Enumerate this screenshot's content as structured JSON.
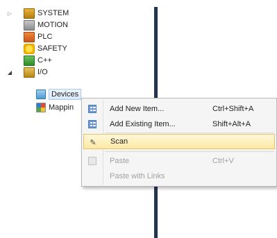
{
  "tree": {
    "items": [
      {
        "label": "SYSTEM",
        "icon": "system-icon",
        "expander": "collapsed"
      },
      {
        "label": "MOTION",
        "icon": "motion-icon"
      },
      {
        "label": "PLC",
        "icon": "plc-icon"
      },
      {
        "label": "SAFETY",
        "icon": "safety-icon"
      },
      {
        "label": "C++",
        "icon": "cpp-icon"
      },
      {
        "label": "I/O",
        "icon": "io-icon",
        "expander": "expanded"
      },
      {
        "label": "Devices",
        "icon": "devices-icon",
        "selected": true
      },
      {
        "label": "Mappin",
        "icon": "mappings-icon"
      }
    ]
  },
  "context_menu": {
    "items": [
      {
        "label": "Add New Item...",
        "shortcut": "Ctrl+Shift+A",
        "icon": "add-new-item-icon",
        "enabled": true
      },
      {
        "label": "Add Existing Item...",
        "shortcut": "Shift+Alt+A",
        "icon": "add-existing-item-icon",
        "enabled": true
      },
      {
        "label": "Scan",
        "shortcut": "",
        "icon": "scan-wand-icon",
        "enabled": true,
        "highlighted": true
      },
      {
        "label": "Paste",
        "shortcut": "Ctrl+V",
        "icon": "paste-icon",
        "enabled": false
      },
      {
        "label": "Paste with Links",
        "shortcut": "",
        "icon": "",
        "enabled": false
      }
    ]
  },
  "colors": {
    "highlight": "#fde9a4",
    "divider_bar": "#24344f"
  }
}
